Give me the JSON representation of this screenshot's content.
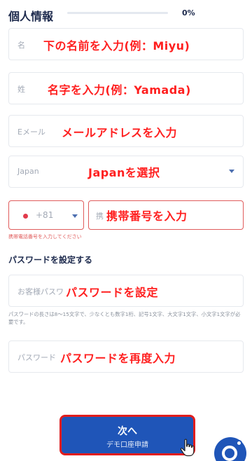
{
  "header": {
    "title": "個人情報",
    "progress_text": "0%",
    "progress_value": 0
  },
  "fields": {
    "first_name_placeholder": "名",
    "last_name_placeholder": "姓",
    "email_placeholder": "Eメール",
    "country_value": "Japan",
    "phone_code": "+81",
    "phone_placeholder": "携",
    "phone_error": "携帯電話番号を入力してください",
    "password_placeholder": "お客様パスワ",
    "password_confirm_placeholder": "パスワード"
  },
  "password_section": {
    "title": "パスワードを設定する",
    "hint": "パスワードの長さは8〜15文字で、少なくとも数字1桁、記号1文字、大文字1文字、小文字1文字が必要です。"
  },
  "callouts": {
    "first_name": "下の名前を入力(例：Miyu)",
    "last_name": "名字を入力(例：Yamada)",
    "email": "メールアドレスを入力",
    "country": "Japanを選択",
    "phone": "携帯番号を入力",
    "password": "パスワードを設定",
    "password_confirm": "パスワードを再度入力"
  },
  "next_button": {
    "label": "次へ",
    "sublabel": "デモ口座申請"
  },
  "icons": {
    "flag": "japan-flag-icon",
    "dropdown": "chevron-down-icon",
    "cursor": "hand-pointer-icon",
    "chat": "chat-icon"
  },
  "colors": {
    "accent": "#1f55b8",
    "callout": "#ff1f1f",
    "error": "#e05c5c"
  }
}
